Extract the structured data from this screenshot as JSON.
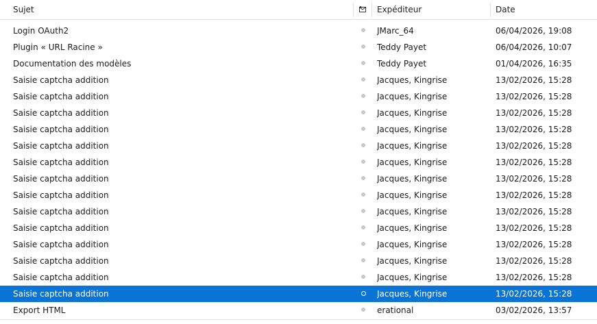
{
  "columns": {
    "subject": "Sujet",
    "read_icon": "read-status-icon",
    "from": "Expéditeur",
    "date": "Date"
  },
  "colors": {
    "selection": "#0a74d6",
    "unread_dot": "#c8c8c8"
  },
  "messages": [
    {
      "subject": "Login OAuth2",
      "from": "JMarc_64",
      "date": "06/04/2026, 19:08"
    },
    {
      "subject": "Plugin « URL Racine »",
      "from": "Teddy Payet",
      "date": "06/04/2026, 10:07"
    },
    {
      "subject": "Documentation des modèles",
      "from": "Teddy Payet",
      "date": "01/04/2026, 16:35"
    },
    {
      "subject": "Saisie captcha addition",
      "from": "Jacques, Kingrise",
      "date": "13/02/2026, 15:28"
    },
    {
      "subject": "Saisie captcha addition",
      "from": "Jacques, Kingrise",
      "date": "13/02/2026, 15:28"
    },
    {
      "subject": "Saisie captcha addition",
      "from": "Jacques, Kingrise",
      "date": "13/02/2026, 15:28"
    },
    {
      "subject": "Saisie captcha addition",
      "from": "Jacques, Kingrise",
      "date": "13/02/2026, 15:28"
    },
    {
      "subject": "Saisie captcha addition",
      "from": "Jacques, Kingrise",
      "date": "13/02/2026, 15:28"
    },
    {
      "subject": "Saisie captcha addition",
      "from": "Jacques, Kingrise",
      "date": "13/02/2026, 15:28"
    },
    {
      "subject": "Saisie captcha addition",
      "from": "Jacques, Kingrise",
      "date": "13/02/2026, 15:28"
    },
    {
      "subject": "Saisie captcha addition",
      "from": "Jacques, Kingrise",
      "date": "13/02/2026, 15:28"
    },
    {
      "subject": "Saisie captcha addition",
      "from": "Jacques, Kingrise",
      "date": "13/02/2026, 15:28"
    },
    {
      "subject": "Saisie captcha addition",
      "from": "Jacques, Kingrise",
      "date": "13/02/2026, 15:28"
    },
    {
      "subject": "Saisie captcha addition",
      "from": "Jacques, Kingrise",
      "date": "13/02/2026, 15:28"
    },
    {
      "subject": "Saisie captcha addition",
      "from": "Jacques, Kingrise",
      "date": "13/02/2026, 15:28"
    },
    {
      "subject": "Saisie captcha addition",
      "from": "Jacques, Kingrise",
      "date": "13/02/2026, 15:28"
    },
    {
      "subject": "Saisie captcha addition",
      "from": "Jacques, Kingrise",
      "date": "13/02/2026, 15:28",
      "selected": true
    },
    {
      "subject": "Export HTML",
      "from": "erational",
      "date": "03/02/2026, 13:57"
    }
  ]
}
